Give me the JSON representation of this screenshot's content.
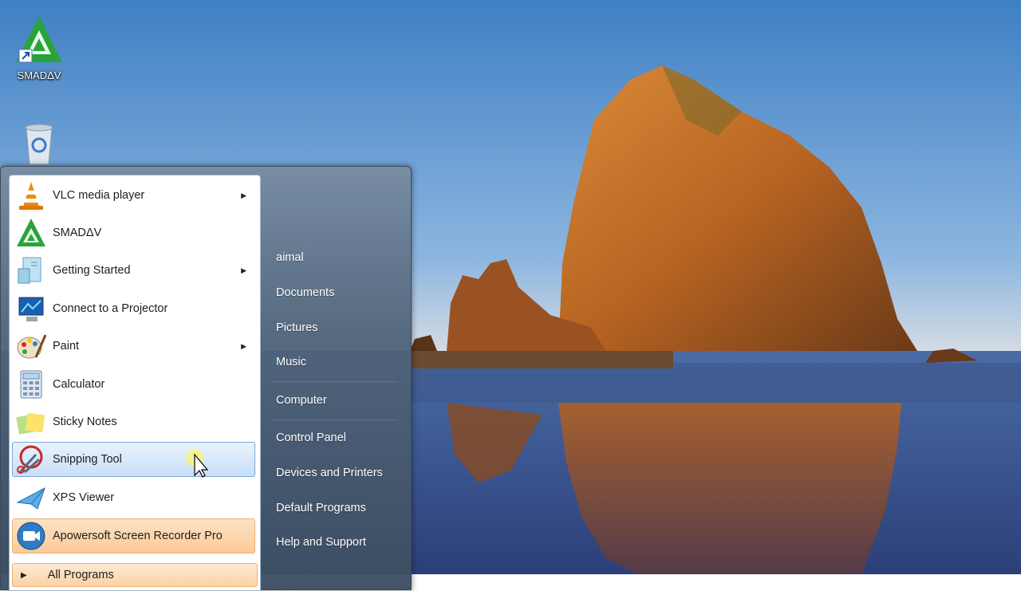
{
  "desktop": {
    "icons": [
      {
        "label": "SMADΔV",
        "icon": "smadav-icon"
      },
      {
        "label": "",
        "icon": "recycle-bin-icon"
      }
    ]
  },
  "start_menu": {
    "programs": [
      {
        "label": "VLC media player",
        "icon": "vlc-cone-icon",
        "submenu": true
      },
      {
        "label": "SMADΔV",
        "icon": "smadav-icon",
        "submenu": false
      },
      {
        "label": "Getting Started",
        "icon": "getting-started-icon",
        "submenu": true
      },
      {
        "label": "Connect to a Projector",
        "icon": "projector-icon",
        "submenu": false
      },
      {
        "label": "Paint",
        "icon": "paint-palette-icon",
        "submenu": true
      },
      {
        "label": "Calculator",
        "icon": "calculator-icon",
        "submenu": false
      },
      {
        "label": "Sticky Notes",
        "icon": "sticky-notes-icon",
        "submenu": false
      },
      {
        "label": "Snipping Tool",
        "icon": "scissors-icon",
        "submenu": false,
        "state": "hover"
      },
      {
        "label": "XPS Viewer",
        "icon": "xps-viewer-icon",
        "submenu": false
      },
      {
        "label": "Apowersoft Screen Recorder Pro",
        "icon": "camera-recorder-icon",
        "submenu": false,
        "state": "new-highlight"
      }
    ],
    "all_programs": "All Programs",
    "right_items": [
      "aimal",
      "Documents",
      "Pictures",
      "Music",
      "Computer",
      "Control Panel",
      "Devices and Printers",
      "Default Programs",
      "Help and Support"
    ]
  },
  "colors": {
    "hover_bg": "#c7dff8",
    "highlight_bg": "#fbc996",
    "menu_glass": "#50647a"
  }
}
